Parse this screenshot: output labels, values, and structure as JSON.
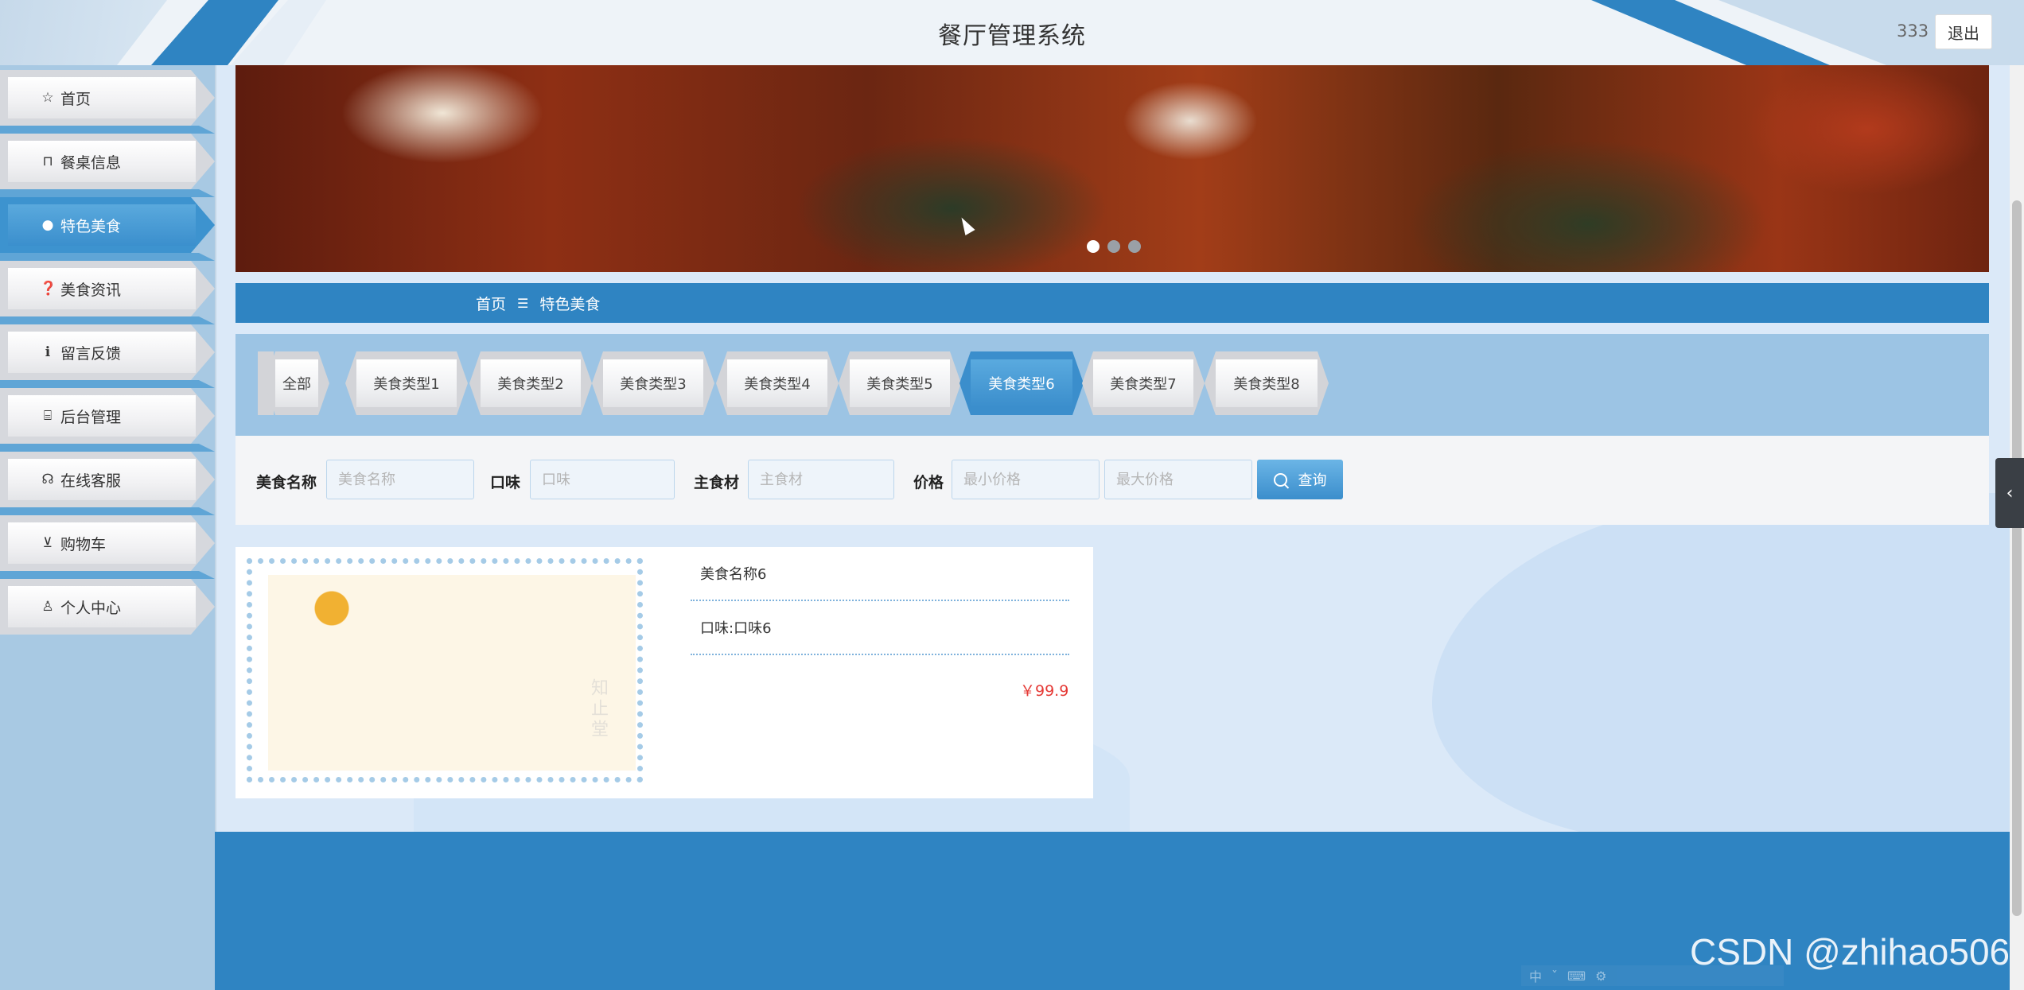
{
  "header": {
    "title": "餐厅管理系统",
    "username": "333",
    "logout_label": "退出"
  },
  "sidebar": {
    "items": [
      {
        "label": "首页",
        "icon": "star-icon",
        "glyph": "☆"
      },
      {
        "label": "餐桌信息",
        "icon": "bag-icon",
        "glyph": "⊓"
      },
      {
        "label": "特色美食",
        "icon": "circle-icon",
        "glyph": "●"
      },
      {
        "label": "美食资讯",
        "icon": "question-icon",
        "glyph": "❓"
      },
      {
        "label": "留言反馈",
        "icon": "info-icon",
        "glyph": "ℹ"
      },
      {
        "label": "后台管理",
        "icon": "briefcase-icon",
        "glyph": "⌸"
      },
      {
        "label": "在线客服",
        "icon": "headset-icon",
        "glyph": "☊"
      },
      {
        "label": "购物车",
        "icon": "cart-icon",
        "glyph": "⊻"
      },
      {
        "label": "个人中心",
        "icon": "user-icon",
        "glyph": "♙"
      }
    ],
    "active_index": 2
  },
  "carousel": {
    "slide_count": 3,
    "active_slide": 0
  },
  "breadcrumb": {
    "home": "首页",
    "separator": "☰",
    "current": "特色美食"
  },
  "categories": {
    "items": [
      "全部",
      "美食类型1",
      "美食类型2",
      "美食类型3",
      "美食类型4",
      "美食类型5",
      "美食类型6",
      "美食类型7",
      "美食类型8"
    ],
    "active_index": 6
  },
  "search": {
    "name_label": "美食名称",
    "name_placeholder": "美食名称",
    "flavor_label": "口味",
    "flavor_placeholder": "口味",
    "ingredient_label": "主食材",
    "ingredient_placeholder": "主食材",
    "price_label": "价格",
    "min_price_placeholder": "最小价格",
    "max_price_placeholder": "最大价格",
    "button_label": "查询"
  },
  "product": {
    "name": "美食名称6",
    "flavor": "口味:口味6",
    "price": "￥99.9",
    "photo_text": "知止堂"
  },
  "watermark": "CSDN @zhihao506",
  "ime": [
    "中",
    "ˇ",
    "⌨",
    "⚙"
  ],
  "colors": {
    "primary": "#2f84c2",
    "sidebar": "#a8c9e3",
    "price": "#e53935"
  }
}
